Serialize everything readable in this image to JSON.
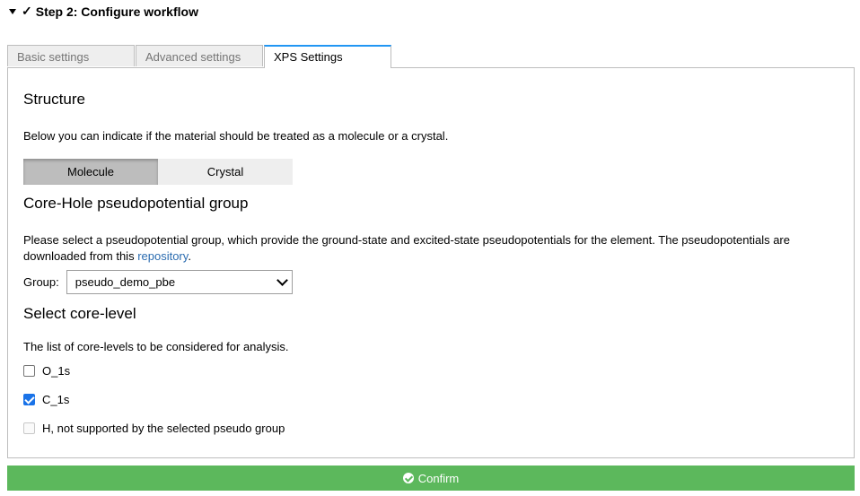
{
  "step": {
    "check": "✓",
    "title": "Step 2: Configure workflow"
  },
  "tabs": [
    {
      "label": "Basic settings"
    },
    {
      "label": "Advanced settings"
    },
    {
      "label": "XPS Settings"
    }
  ],
  "structure": {
    "heading": "Structure",
    "description": "Below you can indicate if the material should be treated as a molecule or a crystal.",
    "options": [
      "Molecule",
      "Crystal"
    ],
    "selected": "Molecule"
  },
  "core_hole": {
    "heading": "Core-Hole pseudopotential group",
    "description_line1": "Please select a pseudopotential group, which provide the ground-state and excited-state pseudopotentials for the element. The pseudopotentials are",
    "description_line2_prefix": "downloaded from this ",
    "link_text": "repository",
    "description_line2_suffix": ".",
    "group_label": "Group:",
    "group_value": "pseudo_demo_pbe"
  },
  "core_level": {
    "heading": "Select core-level",
    "description": "The list of core-levels to be considered for analysis.",
    "items": [
      {
        "label": "O_1s",
        "checked": false,
        "disabled": false
      },
      {
        "label": "C_1s",
        "checked": true,
        "disabled": false
      },
      {
        "label": "H, not supported by the selected pseudo group",
        "checked": false,
        "disabled": true
      }
    ]
  },
  "confirm": {
    "label": "Confirm"
  },
  "colors": {
    "accent": "#2196f3",
    "confirm": "#5cb85c",
    "link": "#2b6cb0"
  }
}
